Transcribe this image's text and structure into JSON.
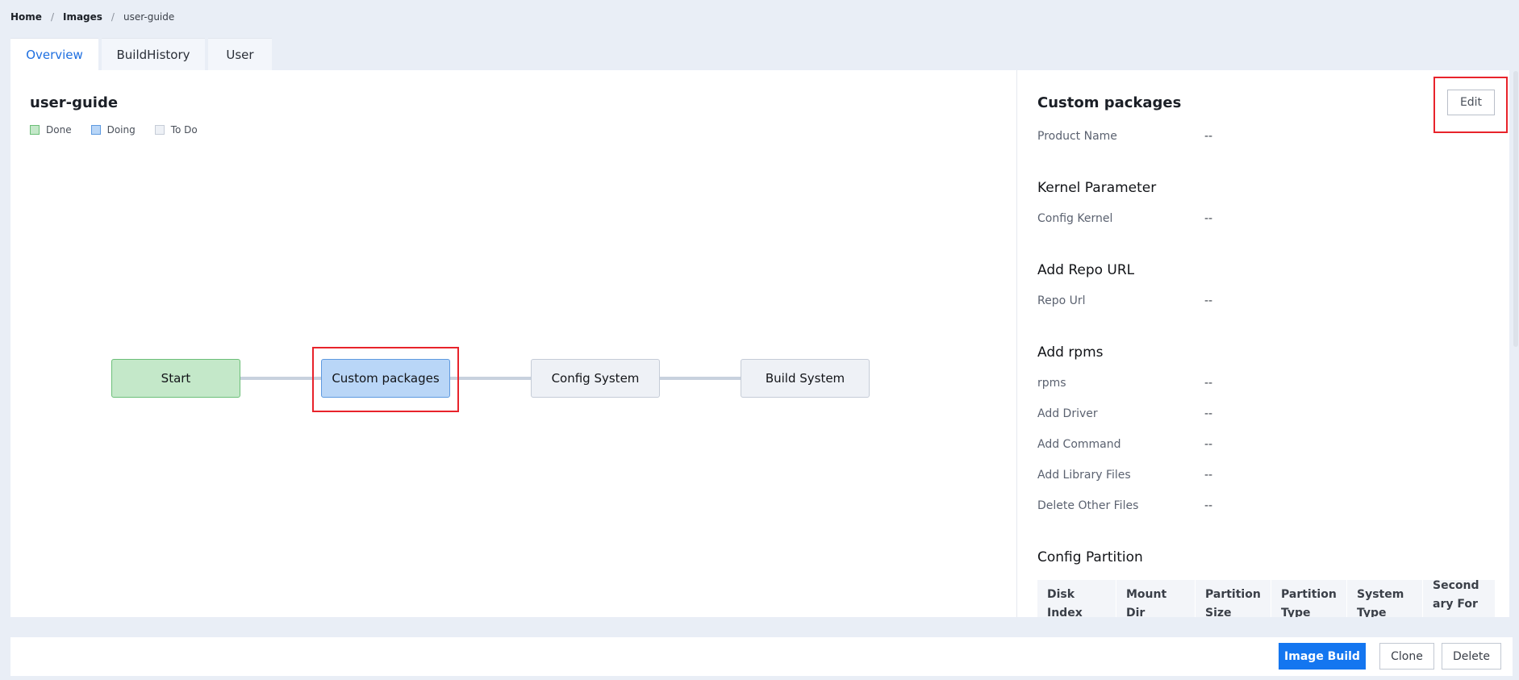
{
  "breadcrumb": {
    "home": "Home",
    "images": "Images",
    "current": "user-guide",
    "sep": "/"
  },
  "tabs": [
    {
      "label": "Overview"
    },
    {
      "label": "BuildHistory"
    },
    {
      "label": "User"
    }
  ],
  "overview": {
    "title": "user-guide",
    "legend": [
      {
        "label": "Done",
        "fill": "#c4e8c9",
        "border": "#6cbf78"
      },
      {
        "label": "Doing",
        "fill": "#b9d6f7",
        "border": "#5e9ae0"
      },
      {
        "label": "To Do",
        "fill": "#eef1f6",
        "border": "#c5ccd7"
      }
    ],
    "flow_nodes": [
      {
        "label": "Start",
        "status": "Done"
      },
      {
        "label": "Custom packages",
        "status": "Doing"
      },
      {
        "label": "Config System",
        "status": "To Do"
      },
      {
        "label": "Build System",
        "status": "To Do"
      }
    ]
  },
  "details": {
    "title": "Custom packages",
    "edit_label": "Edit",
    "product_name_label": "Product Name",
    "product_name_value": "--",
    "kernel": {
      "title": "Kernel Parameter",
      "config_kernel_label": "Config Kernel",
      "config_kernel_value": "--"
    },
    "repo": {
      "title": "Add Repo URL",
      "repo_url_label": "Repo Url",
      "repo_url_value": "--"
    },
    "rpms": {
      "title": "Add rpms",
      "fields": [
        {
          "label": "rpms",
          "value": "--"
        },
        {
          "label": "Add Driver",
          "value": "--"
        },
        {
          "label": "Add Command",
          "value": "--"
        },
        {
          "label": "Add Library Files",
          "value": "--"
        },
        {
          "label": "Delete Other Files",
          "value": "--"
        }
      ]
    },
    "partition": {
      "title": "Config Partition",
      "columns": [
        "Disk Index",
        "Mount Dir",
        "Partition Size",
        "Partition Type",
        "System Type",
        "Secondary Format"
      ]
    }
  },
  "footer": {
    "image_build": "Image Build",
    "clone": "Clone",
    "delete": "Delete"
  },
  "colors": {
    "accent": "#1476f0",
    "highlight": "#e8232b"
  }
}
